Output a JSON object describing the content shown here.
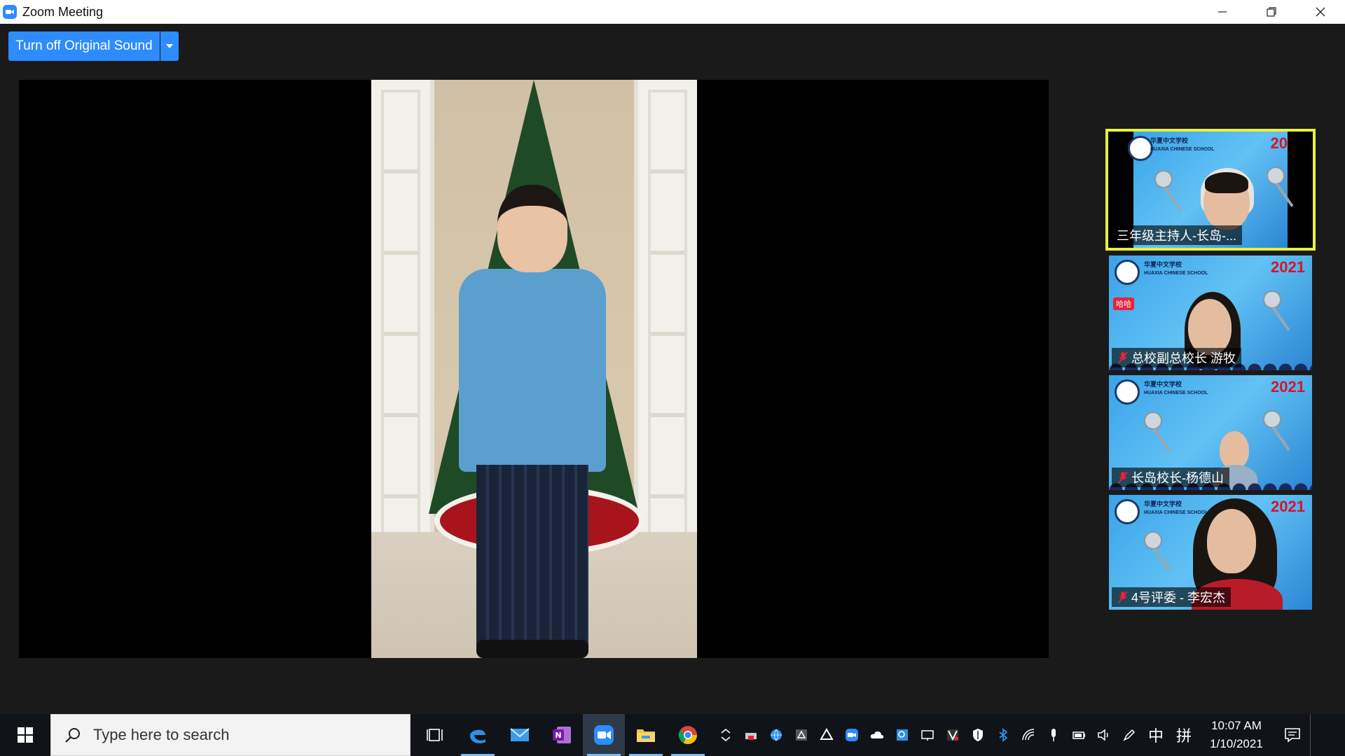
{
  "window": {
    "title": "Zoom Meeting",
    "icon": "zoom-camera-icon"
  },
  "meeting": {
    "original_sound_label": "Turn off Original Sound"
  },
  "participants": [
    {
      "name": "三年级主持人-长岛-...",
      "active_speaker": true,
      "muted": false
    },
    {
      "name": "总校副总校长 游牧",
      "active_speaker": false,
      "muted": true
    },
    {
      "name": "长岛校长-杨德山",
      "active_speaker": false,
      "muted": true
    },
    {
      "name": "4号评委 - 李宏杰",
      "active_speaker": false,
      "muted": true
    }
  ],
  "tile_text": {
    "school": "华夏中文学校",
    "school_en": "HUAXIA CHINESE SCHOOL",
    "year": "2021",
    "year_partial": "20",
    "badge": "哈哈"
  },
  "taskbar": {
    "search_placeholder": "Type here to search",
    "apps": [
      "task-view-icon",
      "edge-icon",
      "mail-icon",
      "onenote-icon",
      "zoom-icon",
      "file-explorer-icon",
      "chrome-icon"
    ],
    "ime_chinese": "中",
    "ime_grid": "拼",
    "time": "10:07 AM",
    "date": "1/10/2021"
  },
  "colors": {
    "zoom_blue": "#2d8cff",
    "active_speaker_border": "#e6f23c",
    "taskbar": "#101418"
  }
}
